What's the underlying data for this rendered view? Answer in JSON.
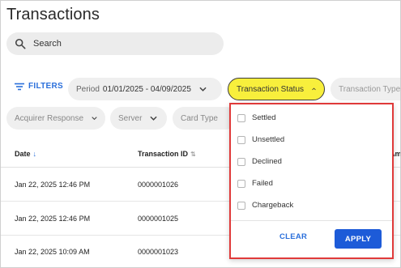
{
  "page": {
    "title": "Transactions"
  },
  "search": {
    "placeholder": "Search"
  },
  "filters": {
    "label": "FILTERS",
    "chips": {
      "period": {
        "label": "Period",
        "value": "01/01/2025 - 04/09/2025"
      },
      "status": {
        "label": "Transaction Status"
      },
      "type": {
        "label": "Transaction Type"
      },
      "acquirer": {
        "label": "Acquirer Response"
      },
      "server": {
        "label": "Server"
      },
      "card": {
        "label": "Card Type"
      }
    }
  },
  "table": {
    "columns": {
      "date": "Date",
      "txn_id": "Transaction ID",
      "amount": "Amou"
    },
    "sort_icons": {
      "date": "↓",
      "txn_id": "⇅"
    },
    "rows": [
      {
        "date": "Jan 22, 2025 12:46 PM",
        "txn_id": "0000001026"
      },
      {
        "date": "Jan 22, 2025 12:46 PM",
        "txn_id": "0000001025"
      },
      {
        "date": "Jan 22, 2025 10:09 AM",
        "txn_id": "0000001023"
      }
    ]
  },
  "status_dropdown": {
    "options": [
      {
        "label": "Settled",
        "checked": false
      },
      {
        "label": "Unsettled",
        "checked": false
      },
      {
        "label": "Declined",
        "checked": false
      },
      {
        "label": "Failed",
        "checked": false
      },
      {
        "label": "Chargeback",
        "checked": false
      }
    ],
    "clear_label": "CLEAR",
    "apply_label": "APPLY"
  },
  "colors": {
    "accent": "#2a6fdb",
    "apply_bg": "#1d5bd8",
    "active_chip": "#f8ef3c",
    "highlight_border": "#e03a3a"
  },
  "icons": {
    "search": "search-icon",
    "filters": "filter-lines-icon",
    "chevron": "chevron-down-icon",
    "chevron_up": "chevron-up-icon"
  }
}
